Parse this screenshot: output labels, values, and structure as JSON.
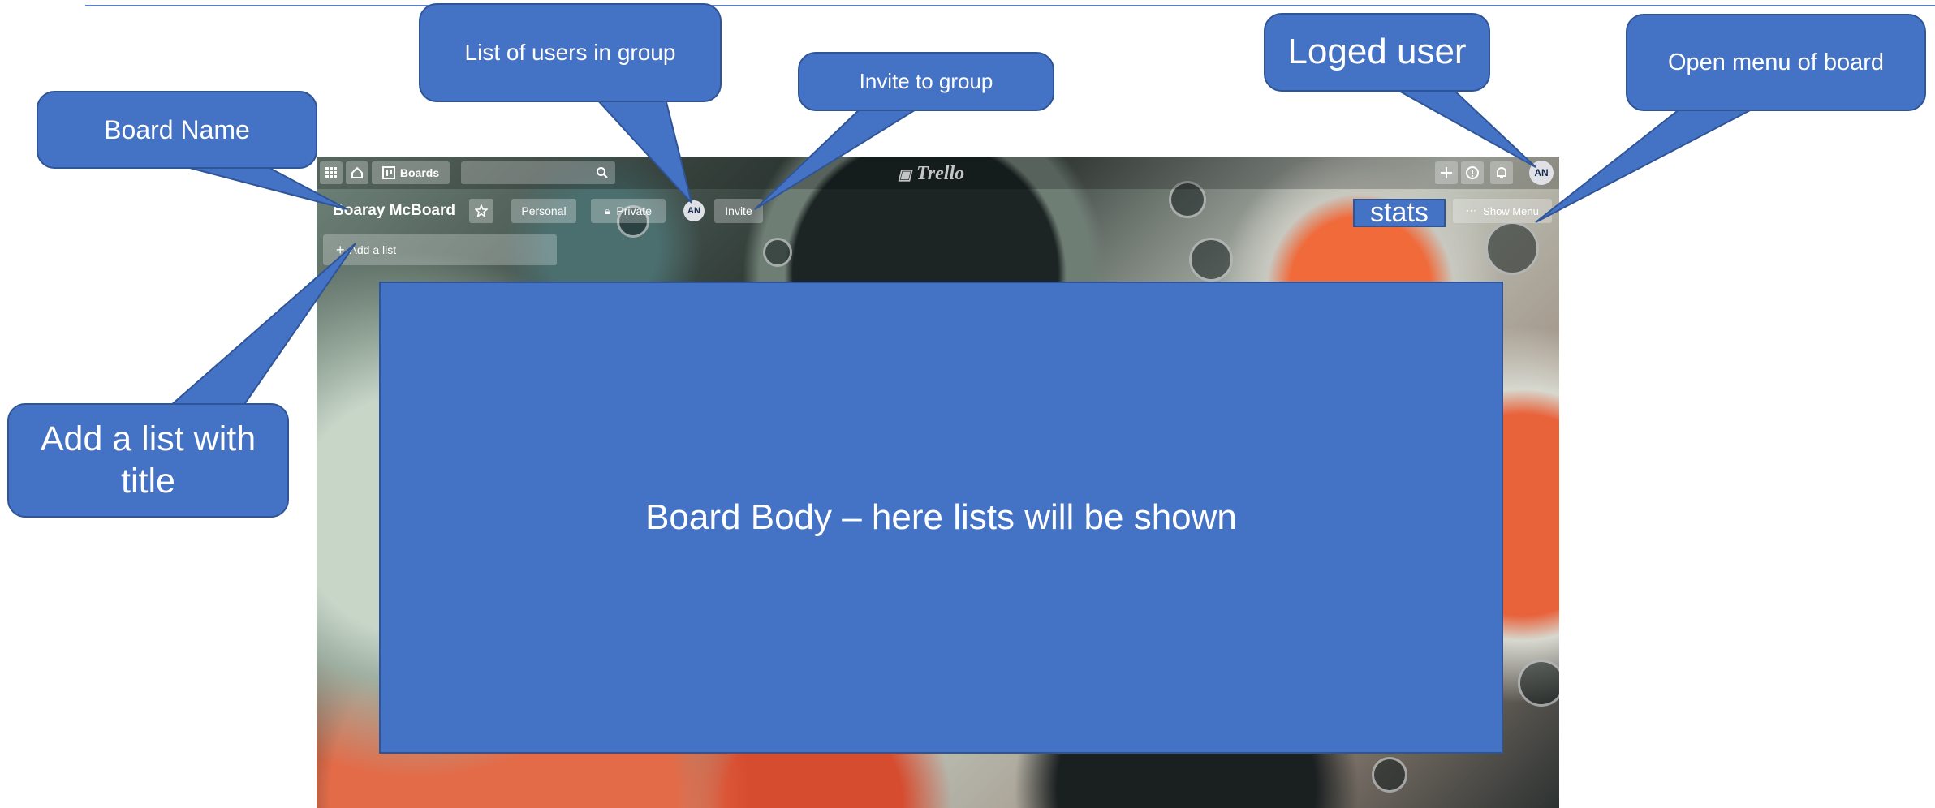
{
  "app": {
    "boards_label": "Boards",
    "logo_text": "Trello",
    "user_initials": "AN"
  },
  "board": {
    "name": "Boaray McBoard",
    "team_label": "Personal",
    "visibility_label": "Private",
    "member_initials": "AN",
    "invite_label": "Invite",
    "show_menu_label": "Show Menu",
    "add_list_label": "Add a list"
  },
  "annotations": {
    "board_name": "Board Name",
    "users_in_group": "List of users in group",
    "invite_to_group": "Invite to group",
    "logged_user": "Loged user",
    "open_menu": "Open menu of board",
    "add_list": "Add a list with title",
    "stats": "stats",
    "board_body": "Board Body – here lists will be shown"
  },
  "colors": {
    "callout_fill": "#4472c4",
    "callout_border": "#2f5597"
  },
  "icons": [
    "apps-grid-icon",
    "home-icon",
    "boards-icon",
    "search-icon",
    "plus-icon",
    "info-icon",
    "bell-icon",
    "star-icon",
    "lock-icon",
    "ellipsis-icon"
  ]
}
